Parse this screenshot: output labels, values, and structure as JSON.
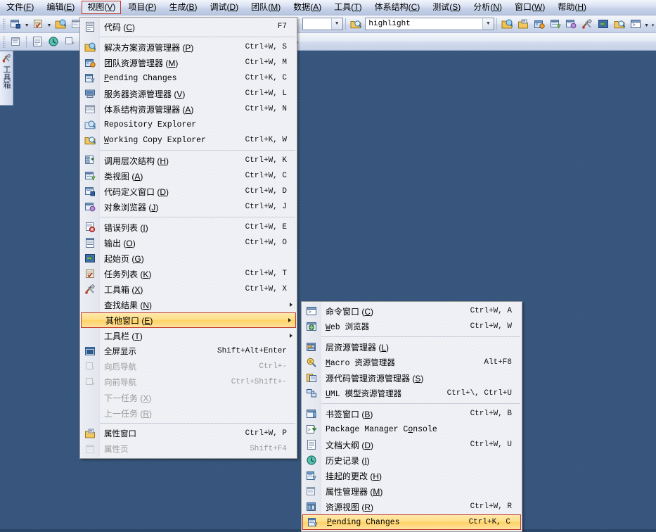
{
  "menubar": {
    "items": [
      {
        "text": "文件",
        "mnemonic": "F",
        "active": false
      },
      {
        "text": "编辑",
        "mnemonic": "E",
        "active": false
      },
      {
        "text": "视图",
        "mnemonic": "V",
        "active": true
      },
      {
        "text": "项目",
        "mnemonic": "P",
        "active": false
      },
      {
        "text": "生成",
        "mnemonic": "B",
        "active": false
      },
      {
        "text": "调试",
        "mnemonic": "D",
        "active": false
      },
      {
        "text": "团队",
        "mnemonic": "M",
        "active": false
      },
      {
        "text": "数据",
        "mnemonic": "A",
        "active": false
      },
      {
        "text": "工具",
        "mnemonic": "T",
        "active": false
      },
      {
        "text": "体系结构",
        "mnemonic": "C",
        "active": false
      },
      {
        "text": "测试",
        "mnemonic": "S",
        "active": false
      },
      {
        "text": "分析",
        "mnemonic": "N",
        "active": false
      },
      {
        "text": "窗口",
        "mnemonic": "W",
        "active": false
      },
      {
        "text": "帮助",
        "mnemonic": "H",
        "active": false
      }
    ]
  },
  "toolbar": {
    "find_combo_value": "highlight",
    "find_combo_placeholder": "",
    "config_combo_value": "",
    "icons": [
      "new-project-icon",
      "new-item-icon",
      "open-file-icon",
      "save-icon",
      "save-all-icon",
      "cut-icon",
      "copy-icon",
      "paste-icon",
      "find-in-files-icon",
      "bookmark-icon",
      "toolbox-icon",
      "solution-explorer-icon",
      "properties-icon",
      "object-browser-icon",
      "toolbox2-icon",
      "start-page-icon",
      "team-explorer-icon",
      "command-window-icon"
    ],
    "overflow_label": "▾"
  },
  "toolbox_tab": {
    "label": "工具箱",
    "icon": "toolbox-icon"
  },
  "view_menu": {
    "name": "视图",
    "items": [
      {
        "icon": "code-icon",
        "label": "代码",
        "mnemonic": "C",
        "shortcut": "F7",
        "mono": false,
        "disabled": false,
        "submenu": false
      },
      {
        "separator": true
      },
      {
        "icon": "solution-explorer-icon",
        "label": "解决方案资源管理器",
        "mnemonic": "P",
        "shortcut": "Ctrl+W, S",
        "mono": false,
        "disabled": false,
        "submenu": false
      },
      {
        "icon": "team-explorer-icon",
        "label": "团队资源管理器",
        "mnemonic": "M",
        "shortcut": "Ctrl+W, M",
        "mono": false,
        "disabled": false,
        "submenu": false
      },
      {
        "icon": "pending-changes-icon",
        "label": "Pending Changes",
        "mnemonic": "P",
        "shortcut": "Ctrl+K, C",
        "mono": true,
        "disabled": false,
        "submenu": false
      },
      {
        "icon": "server-explorer-icon",
        "label": "服务器资源管理器",
        "mnemonic": "V",
        "shortcut": "Ctrl+W, L",
        "mono": false,
        "disabled": false,
        "submenu": false
      },
      {
        "icon": "architecture-explorer-icon",
        "label": "体系结构资源管理器",
        "mnemonic": "A",
        "shortcut": "Ctrl+W, N",
        "mono": false,
        "disabled": false,
        "submenu": false
      },
      {
        "icon": "repository-explorer-icon",
        "label": "Repository Explorer",
        "mnemonic": "R",
        "shortcut": "",
        "mono": true,
        "disabled": false,
        "submenu": false
      },
      {
        "icon": "working-copy-explorer-icon",
        "label": "Working Copy Explorer",
        "mnemonic": "W",
        "shortcut": "Ctrl+K, W",
        "mono": true,
        "disabled": false,
        "submenu": false
      },
      {
        "separator": true
      },
      {
        "icon": "call-hierarchy-icon",
        "label": "调用层次结构",
        "mnemonic": "H",
        "shortcut": "Ctrl+W, K",
        "mono": false,
        "disabled": false,
        "submenu": false
      },
      {
        "icon": "class-view-icon",
        "label": "类视图",
        "mnemonic": "A",
        "shortcut": "Ctrl+W, C",
        "mono": false,
        "disabled": false,
        "submenu": false
      },
      {
        "icon": "code-definition-icon",
        "label": "代码定义窗口",
        "mnemonic": "D",
        "shortcut": "Ctrl+W, D",
        "mono": false,
        "disabled": false,
        "submenu": false
      },
      {
        "icon": "object-browser-icon",
        "label": "对象浏览器",
        "mnemonic": "J",
        "shortcut": "Ctrl+W, J",
        "mono": false,
        "disabled": false,
        "submenu": false
      },
      {
        "separator": true
      },
      {
        "icon": "error-list-icon",
        "label": "错误列表",
        "mnemonic": "I",
        "shortcut": "Ctrl+W, E",
        "mono": false,
        "disabled": false,
        "submenu": false
      },
      {
        "icon": "output-icon",
        "label": "输出",
        "mnemonic": "O",
        "shortcut": "Ctrl+W, O",
        "mono": false,
        "disabled": false,
        "submenu": false
      },
      {
        "icon": "start-page-icon",
        "label": "起始页",
        "mnemonic": "G",
        "shortcut": "",
        "mono": false,
        "disabled": false,
        "submenu": false
      },
      {
        "icon": "task-list-icon",
        "label": "任务列表",
        "mnemonic": "K",
        "shortcut": "Ctrl+W, T",
        "mono": false,
        "disabled": false,
        "submenu": false
      },
      {
        "icon": "toolbox-icon",
        "label": "工具箱",
        "mnemonic": "X",
        "shortcut": "Ctrl+W, X",
        "mono": false,
        "disabled": false,
        "submenu": false
      },
      {
        "icon": "",
        "label": "查找结果",
        "mnemonic": "N",
        "shortcut": "",
        "mono": false,
        "disabled": false,
        "submenu": true
      },
      {
        "icon": "",
        "label": "其他窗口",
        "mnemonic": "E",
        "shortcut": "",
        "mono": false,
        "disabled": false,
        "submenu": true,
        "selected": true
      },
      {
        "icon": "",
        "label": "工具栏",
        "mnemonic": "T",
        "shortcut": "",
        "mono": false,
        "disabled": false,
        "submenu": true
      },
      {
        "icon": "fullscreen-icon",
        "label": "全屏显示",
        "mnemonic": "U",
        "shortcut": "Shift+Alt+Enter",
        "mono": true,
        "disabled": false,
        "submenu": false
      },
      {
        "icon": "navigate-backward-icon",
        "label": "向后导航",
        "mnemonic": "B",
        "shortcut": "Ctrl+-",
        "mono": true,
        "disabled": true,
        "submenu": false
      },
      {
        "icon": "navigate-forward-icon",
        "label": "向前导航",
        "mnemonic": "F",
        "shortcut": "Ctrl+Shift+-",
        "mono": true,
        "disabled": true,
        "submenu": false
      },
      {
        "icon": "",
        "label": "下一任务",
        "mnemonic": "X",
        "shortcut": "",
        "mono": false,
        "disabled": true,
        "submenu": false
      },
      {
        "icon": "",
        "label": "上一任务",
        "mnemonic": "R",
        "shortcut": "",
        "mono": false,
        "disabled": true,
        "submenu": false
      },
      {
        "separator": true
      },
      {
        "icon": "properties-window-icon",
        "label": "属性窗口",
        "mnemonic": "W",
        "shortcut": "Ctrl+W, P",
        "mono": true,
        "disabled": false,
        "submenu": false
      },
      {
        "icon": "property-pages-icon",
        "label": "属性页",
        "mnemonic": "Y",
        "shortcut": "Shift+F4",
        "mono": true,
        "disabled": true,
        "submenu": false
      }
    ]
  },
  "other_windows_submenu": {
    "name": "其他窗口",
    "items": [
      {
        "icon": "command-window-icon",
        "label": "命令窗口",
        "mnemonic": "C",
        "shortcut": "Ctrl+W, A",
        "mono": false,
        "disabled": false
      },
      {
        "icon": "web-browser-icon",
        "label": "Web 浏览器",
        "mnemonic": "B",
        "shortcut": "Ctrl+W, W",
        "mono": true,
        "disabled": false
      },
      {
        "separator": true
      },
      {
        "icon": "layer-explorer-icon",
        "label": "层资源管理器",
        "mnemonic": "L",
        "shortcut": "",
        "mono": false,
        "disabled": false
      },
      {
        "icon": "macro-explorer-icon",
        "label": "Macro 资源管理器",
        "mnemonic": "M",
        "shortcut": "Alt+F8",
        "mono": true,
        "disabled": false
      },
      {
        "icon": "source-control-explorer-icon",
        "label": "源代码管理资源管理器",
        "mnemonic": "S",
        "shortcut": "",
        "mono": false,
        "disabled": false
      },
      {
        "icon": "uml-model-explorer-icon",
        "label": "UML 模型资源管理器",
        "mnemonic": "U",
        "shortcut": "Ctrl+\\, Ctrl+U",
        "mono": true,
        "disabled": false
      },
      {
        "separator": true
      },
      {
        "icon": "bookmark-window-icon",
        "label": "书签窗口",
        "mnemonic": "B",
        "shortcut": "Ctrl+W, B",
        "mono": false,
        "disabled": false
      },
      {
        "icon": "package-manager-icon",
        "label": "Package Manager Console",
        "mnemonic": "o",
        "shortcut": "",
        "mono": true,
        "disabled": false
      },
      {
        "icon": "document-outline-icon",
        "label": "文档大纲",
        "mnemonic": "D",
        "shortcut": "Ctrl+W, U",
        "mono": false,
        "disabled": false
      },
      {
        "icon": "history-icon",
        "label": "历史记录",
        "mnemonic": "I",
        "shortcut": "",
        "mono": false,
        "disabled": false
      },
      {
        "icon": "pending-changes-icon",
        "label": "挂起的更改",
        "mnemonic": "H",
        "shortcut": "",
        "mono": false,
        "disabled": false
      },
      {
        "icon": "property-manager-icon",
        "label": "属性管理器",
        "mnemonic": "M",
        "shortcut": "",
        "mono": false,
        "disabled": false
      },
      {
        "icon": "resource-view-icon",
        "label": "资源视图",
        "mnemonic": "R",
        "shortcut": "Ctrl+W, R",
        "mono": false,
        "disabled": false
      },
      {
        "icon": "pending-changes-icon",
        "label": "Pending Changes",
        "mnemonic": "P",
        "shortcut": "Ctrl+K, C",
        "mono": true,
        "disabled": false,
        "selected": true
      }
    ]
  },
  "colors": {
    "selection_border": "#c0392b",
    "selection_fill": "#ffdd85",
    "menu_bg": "#f5f6f9",
    "desktop_bg": "#3c5a80",
    "menubar_bg": "#dbe3f2"
  }
}
